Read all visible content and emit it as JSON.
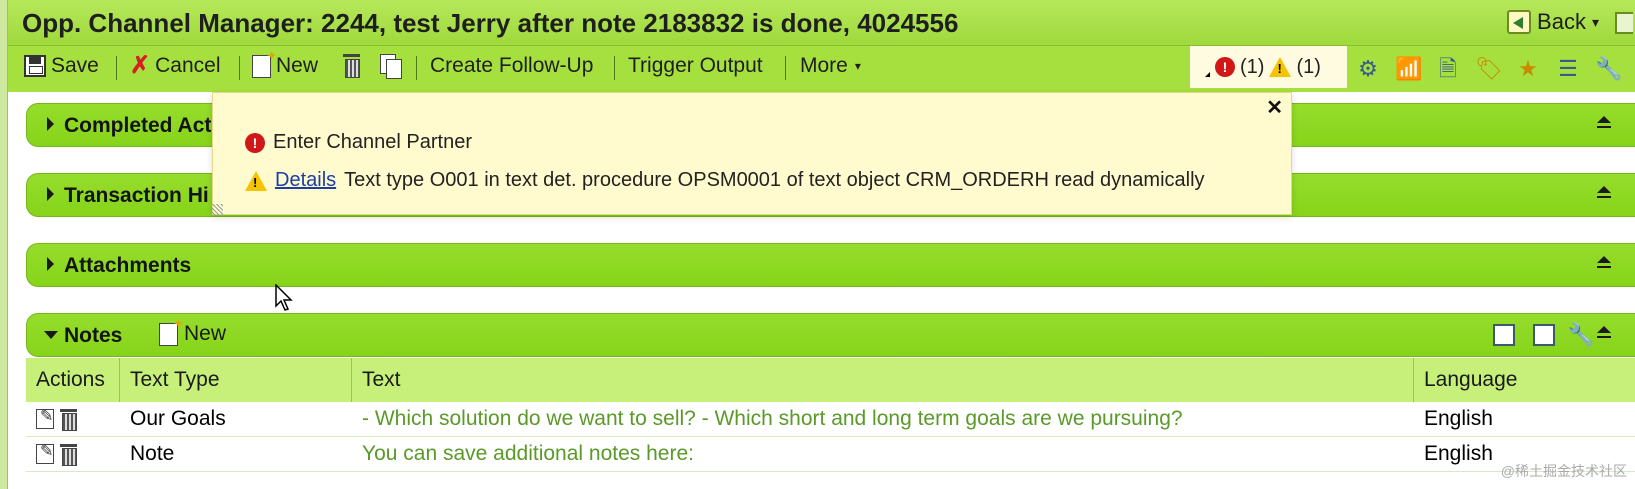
{
  "window": {
    "title": "Opp. Channel Manager: 2244, test Jerry after note 2183832 is done, 4024556",
    "back_label": "Back"
  },
  "toolbar": {
    "save_label": "Save",
    "cancel_label": "Cancel",
    "new_label": "New",
    "create_followup_label": "Create Follow-Up",
    "trigger_output_label": "Trigger Output",
    "more_label": "More"
  },
  "messages": {
    "error_count": "(1)",
    "warning_count": "(1)"
  },
  "popup": {
    "error_text": "Enter Channel Partner",
    "details_link": "Details",
    "warning_text": "Text type O001 in text det. procedure OPSM0001 of text object CRM_ORDERH read dynamically"
  },
  "blocks": {
    "completed": "Completed Act",
    "transaction_history": "Transaction Hi",
    "attachments": "Attachments",
    "notes": "Notes"
  },
  "notes": {
    "new_label": "New",
    "columns": [
      "Actions",
      "Text Type",
      "Text",
      "Language"
    ],
    "rows": [
      {
        "text_type": "Our Goals",
        "text": "- Which solution do we want to sell? - Which short and long term goals are we pursuing?",
        "language": "English"
      },
      {
        "text_type": "Note",
        "text": "You can save additional notes here:",
        "language": "English"
      }
    ]
  },
  "watermark": "@稀土掘金技术社区",
  "colors": {
    "accent": "#96dd2c",
    "toolbar": "#a5e03e",
    "note_text": "#5a9a28",
    "link": "#1a3ea6"
  }
}
